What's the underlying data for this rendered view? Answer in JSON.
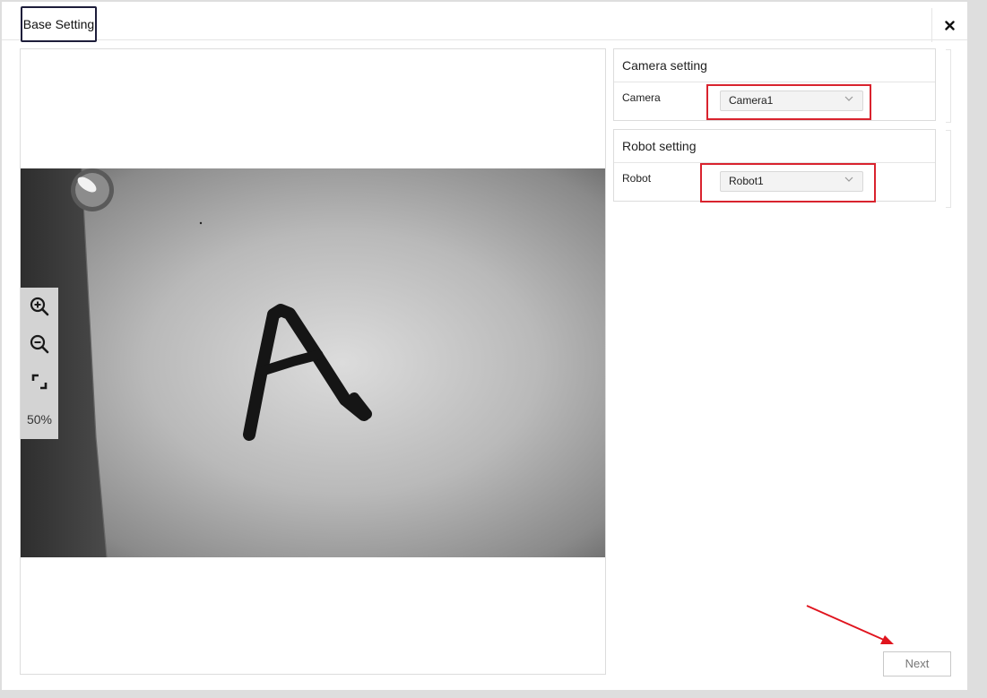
{
  "dialog": {
    "tabs": [
      {
        "label": "Base Setting",
        "active": true
      }
    ],
    "close_icon": "close-icon"
  },
  "viewer": {
    "zoom_level": "50%",
    "tools": [
      "zoom-in-icon",
      "zoom-out-icon",
      "fit-screen-icon"
    ],
    "image_content": "A"
  },
  "camera_setting": {
    "title": "Camera setting",
    "field_label": "Camera",
    "selected": "Camera1"
  },
  "robot_setting": {
    "title": "Robot setting",
    "field_label": "Robot",
    "selected": "Robot1"
  },
  "footer": {
    "next_label": "Next"
  },
  "colors": {
    "highlight": "#d9232e",
    "annotation_arrow": "#e0141e",
    "tab_border": "#1d1d3a"
  }
}
